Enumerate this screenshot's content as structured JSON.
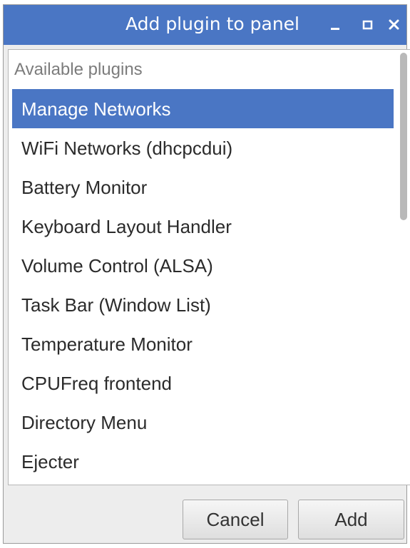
{
  "window": {
    "title": "Add plugin to panel",
    "controls": {
      "minimize_icon": "minimize-icon",
      "maximize_icon": "maximize-icon",
      "close_icon": "close-icon"
    }
  },
  "list": {
    "header": "Available plugins",
    "selected_index": 0,
    "items": [
      {
        "label": "Manage Networks"
      },
      {
        "label": "WiFi Networks (dhcpcdui)"
      },
      {
        "label": "Battery Monitor"
      },
      {
        "label": "Keyboard Layout Handler"
      },
      {
        "label": "Volume Control (ALSA)"
      },
      {
        "label": "Task Bar (Window List)"
      },
      {
        "label": "Temperature Monitor"
      },
      {
        "label": "CPUFreq frontend"
      },
      {
        "label": "Directory Menu"
      },
      {
        "label": "Ejecter"
      }
    ]
  },
  "buttons": {
    "cancel_label": "Cancel",
    "add_label": "Add"
  },
  "colors": {
    "accent": "#4a76c4",
    "window_bg": "#ededed",
    "list_bg": "#ffffff"
  }
}
